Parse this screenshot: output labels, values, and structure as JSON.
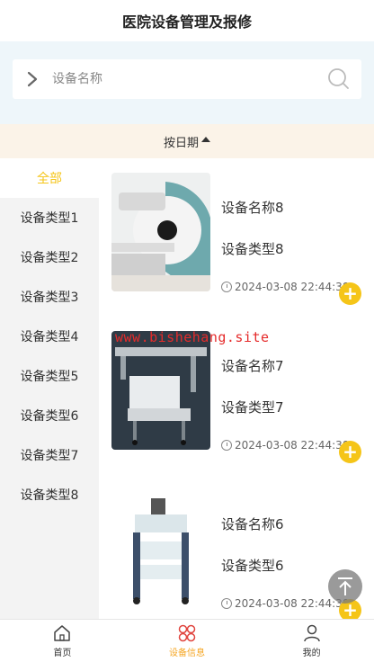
{
  "header": {
    "title": "医院设备管理及报修"
  },
  "search": {
    "placeholder": "设备名称"
  },
  "sort": {
    "label": "按日期"
  },
  "sidebar": {
    "items": [
      {
        "label": "全部",
        "active": true
      },
      {
        "label": "设备类型1"
      },
      {
        "label": "设备类型2"
      },
      {
        "label": "设备类型3"
      },
      {
        "label": "设备类型4"
      },
      {
        "label": "设备类型5"
      },
      {
        "label": "设备类型6"
      },
      {
        "label": "设备类型7"
      },
      {
        "label": "设备类型8"
      }
    ]
  },
  "list": {
    "items": [
      {
        "name": "设备名称8",
        "type": "设备类型8",
        "time": "2024-03-08 22:44:38"
      },
      {
        "name": "设备名称7",
        "type": "设备类型7",
        "time": "2024-03-08 22:44:38"
      },
      {
        "name": "设备名称6",
        "type": "设备类型6",
        "time": "2024-03-08 22:44:38"
      }
    ]
  },
  "watermark": "www.bishehang.site",
  "tabbar": {
    "items": [
      {
        "label": "首页",
        "icon": "home-icon"
      },
      {
        "label": "设备信息",
        "icon": "grid-icon",
        "active": true
      },
      {
        "label": "我的",
        "icon": "user-icon"
      }
    ]
  },
  "colors": {
    "accent": "#f5c518",
    "tab_active": "#f5a623",
    "watermark": "#e52b2b"
  }
}
